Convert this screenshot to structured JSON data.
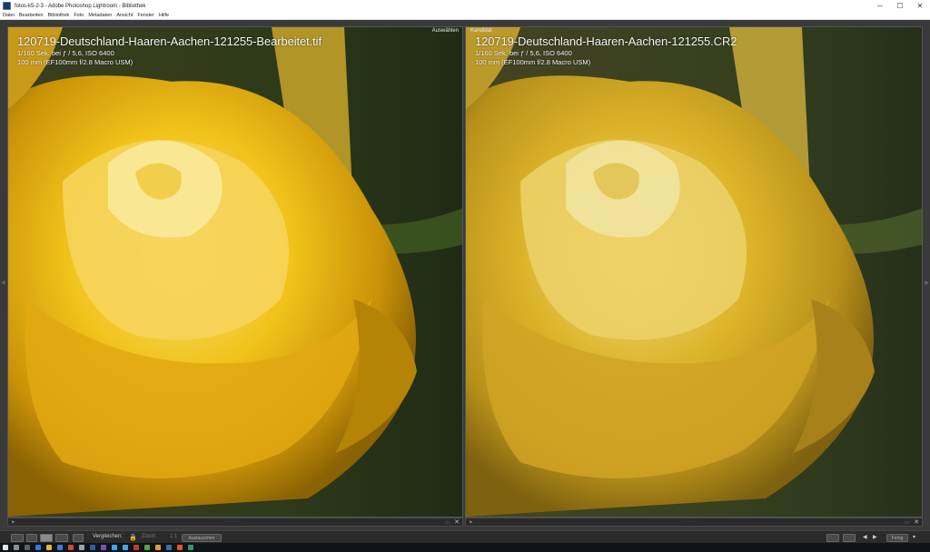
{
  "window": {
    "title": "fotos-k5-2-3 - Adobe Photoshop Lightroom - Bibliothek",
    "minimize": "─",
    "maximize": "☐",
    "close": "✕"
  },
  "menu": [
    "Datei",
    "Bearbeiten",
    "Bibliothek",
    "Foto",
    "Metadaten",
    "Ansicht",
    "Fenster",
    "Hilfe"
  ],
  "left_pane": {
    "tag": "Auswählen",
    "filename": "120719-Deutschland-Haaren-Aachen-121255-Bearbeitet.tif",
    "exposure": "1/160 Sek. bei ƒ / 5,6, ISO 6400",
    "lens": "100 mm (EF100mm f/2.8 Macro USM)"
  },
  "right_pane": {
    "tag": "Kandidat",
    "filename": "120719-Deutschland-Haaren-Aachen-121255.CR2",
    "exposure": "1/160 Sek. bei ƒ / 5,6, ISO 6400",
    "lens": "100 mm (EF100mm f/2.8 Macro USM)"
  },
  "toolbar": {
    "compare_label": "Vergleichen:",
    "zoom_label": "Zoom",
    "zoom_value": "1:1",
    "swap_label": "Austauschen",
    "fertig_label": "Fertig"
  },
  "colors": {
    "accent": "#f0c21a",
    "background": "#3a3a3a",
    "rose_left": "#e8b82a",
    "rose_right": "#d9b02c"
  }
}
